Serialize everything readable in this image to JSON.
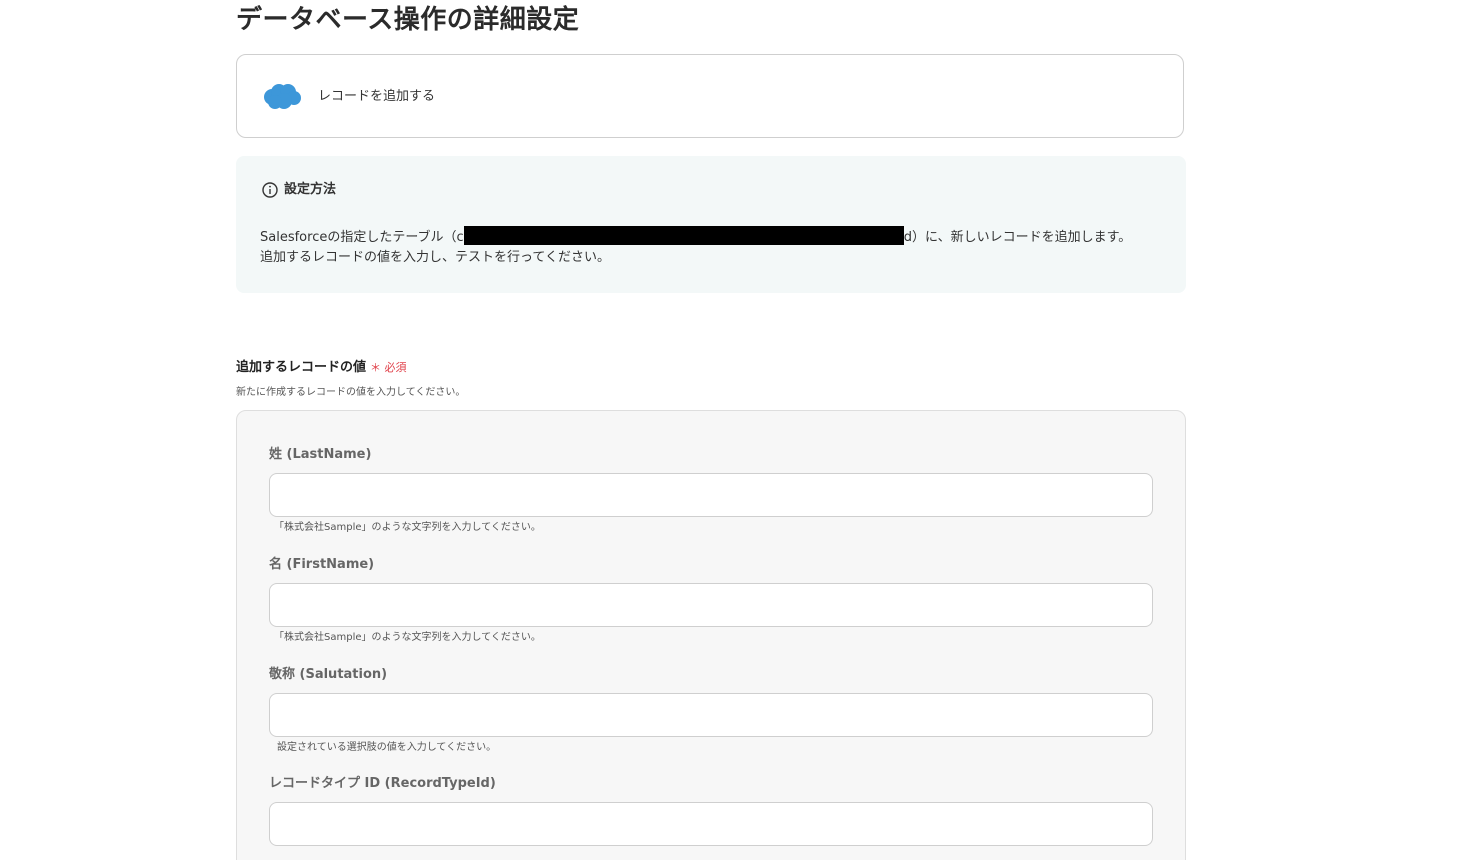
{
  "page": {
    "title": "データベース操作の詳細設定"
  },
  "action": {
    "label": "レコードを追加する",
    "icon": "salesforce-cloud-icon",
    "icon_color": "#3d97d9"
  },
  "info": {
    "heading": "設定方法",
    "line1_prefix": "Salesforceの指定したテーブル（c",
    "line1_suffix": "d）に、新しいレコードを追加します。",
    "line2": "追加するレコードの値を入力し、テストを行ってください。"
  },
  "section": {
    "label": "追加するレコードの値",
    "required": "＊ 必須",
    "required_color": "#e0424b",
    "description": "新たに作成するレコードの値を入力してください。"
  },
  "fields": [
    {
      "label": "姓 (LastName)",
      "value": "",
      "hint": "「株式会社Sample」のような文字列を入力してください。"
    },
    {
      "label": "名 (FirstName)",
      "value": "",
      "hint": "「株式会社Sample」のような文字列を入力してください。"
    },
    {
      "label": "敬称 (Salutation)",
      "value": "",
      "hint": "設定されている選択肢の値を入力してください。"
    },
    {
      "label": "レコードタイプ ID (RecordTypeId)",
      "value": ""
    }
  ]
}
